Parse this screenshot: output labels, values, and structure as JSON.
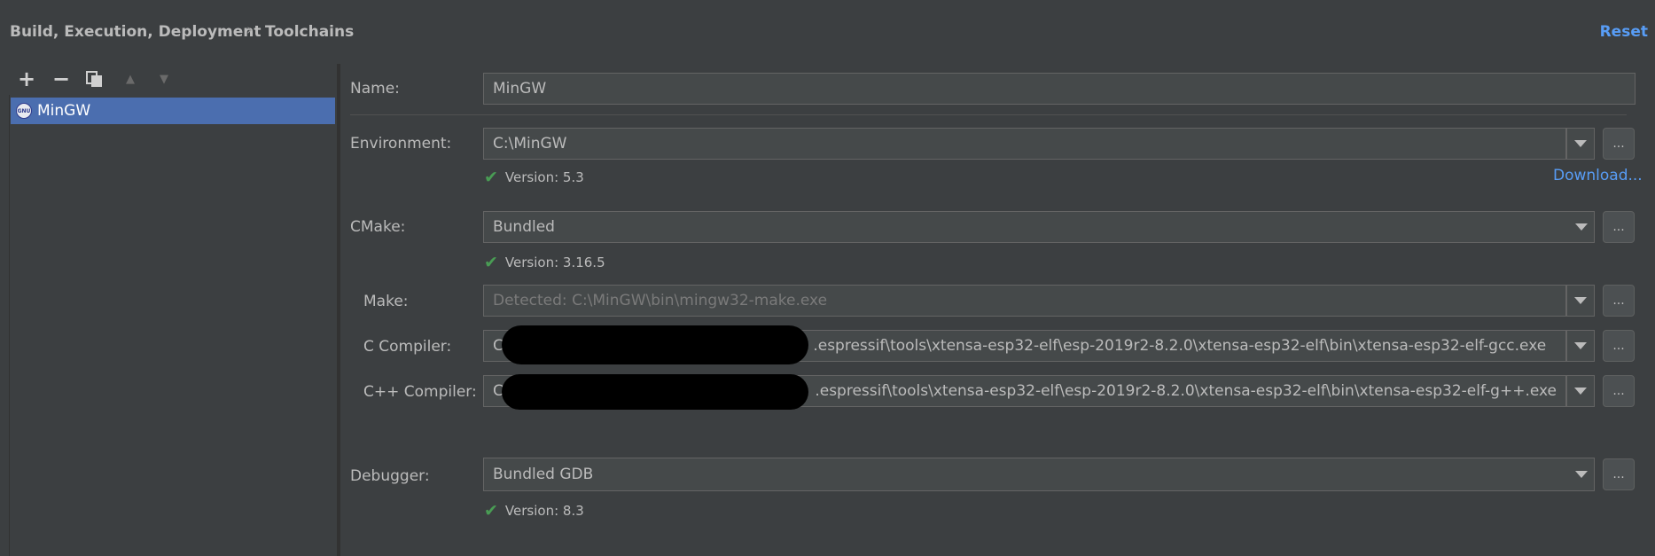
{
  "header": {
    "breadcrumb_parent": "Build, Execution, Deployment",
    "breadcrumb_separator": "›",
    "breadcrumb_current": "Toolchains",
    "reset_label": "Reset"
  },
  "toolbar": {
    "add": "+",
    "remove": "−",
    "up": "▲",
    "down": "▼"
  },
  "toolchains": [
    {
      "icon": "gnu-icon",
      "icon_text": "GNU",
      "name": "MinGW",
      "selected": true
    }
  ],
  "form": {
    "name": {
      "label": "Name:",
      "value": "MinGW"
    },
    "environment": {
      "label": "Environment:",
      "value": "C:\\MinGW",
      "status": "Version: 5.3",
      "download_label": "Download..."
    },
    "cmake": {
      "label": "CMake:",
      "value": "Bundled",
      "status": "Version: 3.16.5"
    },
    "make": {
      "label": "Make:",
      "placeholder": "Detected: C:\\MinGW\\bin\\mingw32-make.exe"
    },
    "c_compiler": {
      "label": "C Compiler:",
      "value_prefix": "C:\\",
      "value_suffix": ".espressif\\tools\\xtensa-esp32-elf\\esp-2019r2-8.2.0\\xtensa-esp32-elf\\bin\\xtensa-esp32-elf-gcc.exe"
    },
    "cpp_compiler": {
      "label": "C++ Compiler:",
      "value_prefix": "C:\\",
      "value_suffix": ".espressif\\tools\\xtensa-esp32-elf\\esp-2019r2-8.2.0\\xtensa-esp32-elf\\bin\\xtensa-esp32-elf-g++.exe"
    },
    "debugger": {
      "label": "Debugger:",
      "value": "Bundled GDB",
      "status": "Version: 8.3"
    },
    "browse_label": "...",
    "check_glyph": "✔"
  },
  "colors": {
    "background": "#3c3f41",
    "selection": "#4b6eaf",
    "link": "#589df6",
    "success": "#499c54"
  }
}
